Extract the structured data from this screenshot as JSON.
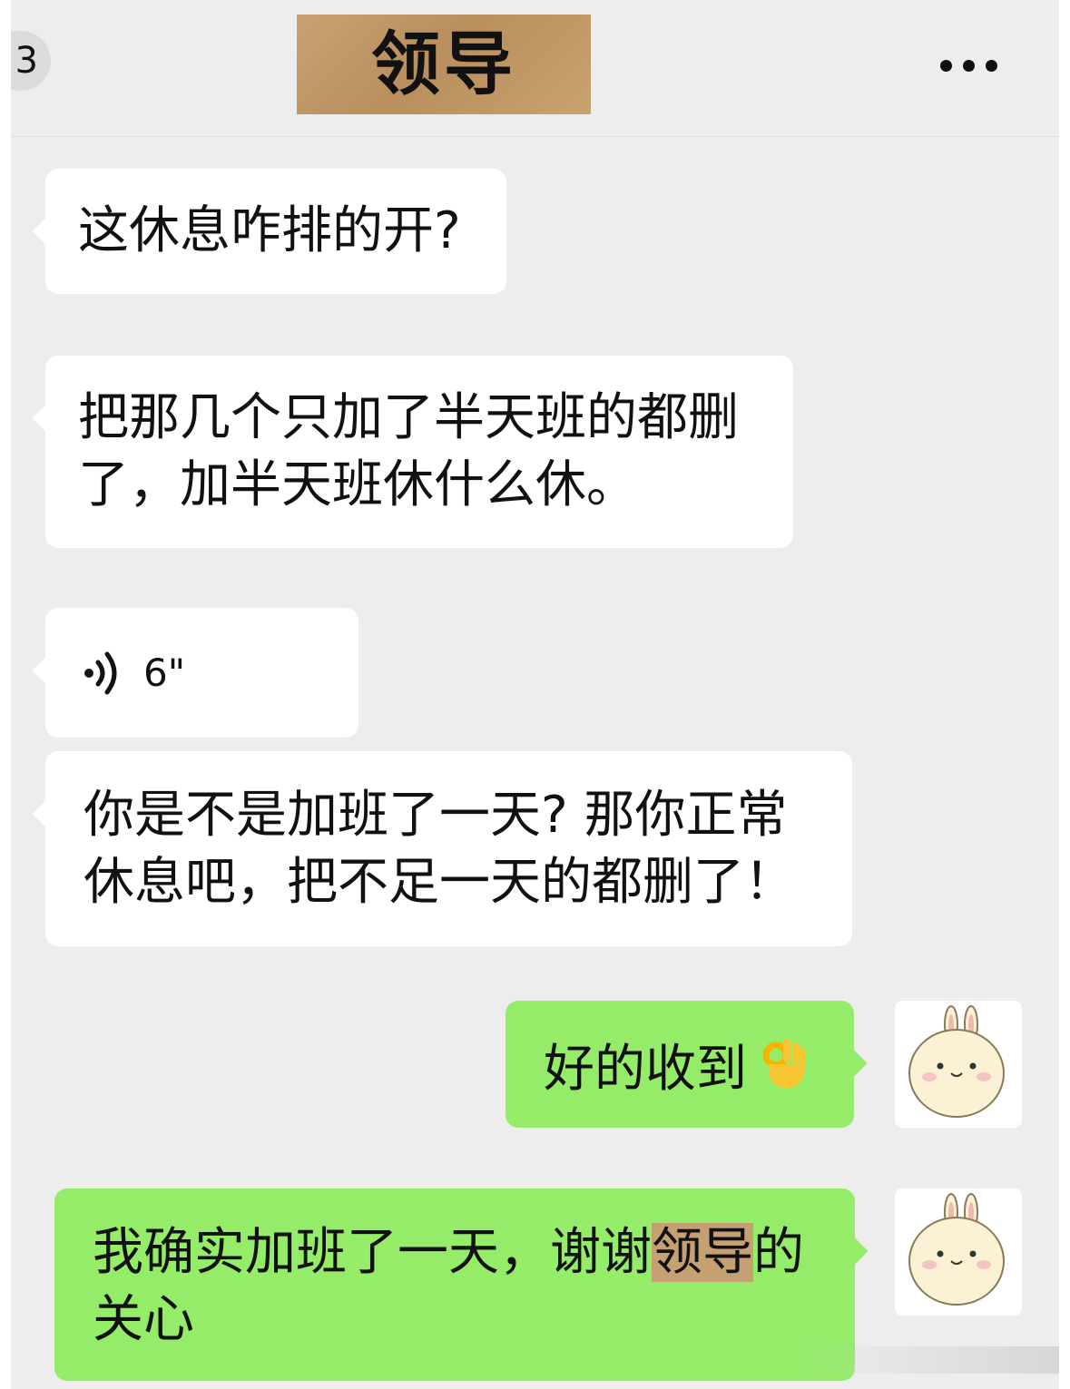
{
  "header": {
    "back_badge": "3",
    "title": "领导",
    "more_icon": "more-dots-icon"
  },
  "messages": [
    {
      "side": "incoming",
      "type": "text",
      "text": "这休息咋排的开?"
    },
    {
      "side": "incoming",
      "type": "text",
      "lines": [
        "把那几个只加了半天班的都删",
        "了，加半天班休什么休。"
      ]
    },
    {
      "side": "incoming",
      "type": "voice",
      "duration": "6\"",
      "icon": "voice-wave-icon"
    },
    {
      "side": "incoming",
      "type": "text",
      "lines": [
        "你是不是加班了一天? 那你正常",
        "休息吧，把不足一天的都删了！"
      ]
    },
    {
      "side": "outgoing",
      "type": "text",
      "text": "好的收到",
      "emoji": "ok-hand-icon"
    },
    {
      "side": "outgoing",
      "type": "text",
      "line1_a": "我确实加班了一天，谢谢",
      "line1_highlight": "领导",
      "line1_b": "的",
      "line2": "关心"
    }
  ],
  "avatar": {
    "icon": "bunny-avatar-icon"
  },
  "colors": {
    "background": "#ededed",
    "incoming_bubble": "#ffffff",
    "outgoing_bubble": "#95ec69",
    "title_tag": "#c09a6b"
  }
}
